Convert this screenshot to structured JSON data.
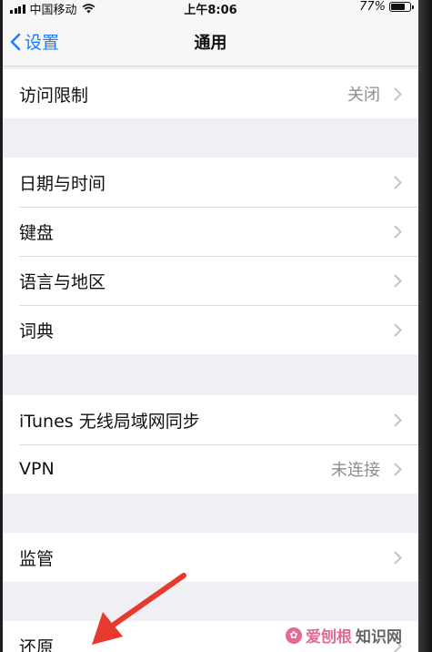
{
  "status_bar": {
    "carrier": "中国移动",
    "time": "上午8:06",
    "battery_percent_text": "77%",
    "battery_level": 0.77
  },
  "nav": {
    "back_label": "设置",
    "title": "通用"
  },
  "groups": [
    {
      "rows": [
        {
          "label": "访问限制",
          "value": "关闭"
        }
      ]
    },
    {
      "rows": [
        {
          "label": "日期与时间"
        },
        {
          "label": "键盘"
        },
        {
          "label": "语言与地区"
        },
        {
          "label": "词典"
        }
      ]
    },
    {
      "rows": [
        {
          "label": "iTunes 无线局域网同步"
        },
        {
          "label": "VPN",
          "value": "未连接"
        }
      ]
    },
    {
      "rows": [
        {
          "label": "监管"
        }
      ]
    },
    {
      "rows": [
        {
          "label": "还原"
        }
      ]
    }
  ],
  "watermark": {
    "part1": "爱刨根",
    "part2": "知识网"
  },
  "colors": {
    "accent": "#1a7dfa",
    "annotation_arrow": "#e8392e",
    "background": "#efeff4"
  },
  "icons": {
    "back": "chevron-left-icon",
    "row_disclosure": "chevron-right-icon",
    "wifi": "wifi-icon",
    "battery": "battery-icon"
  }
}
